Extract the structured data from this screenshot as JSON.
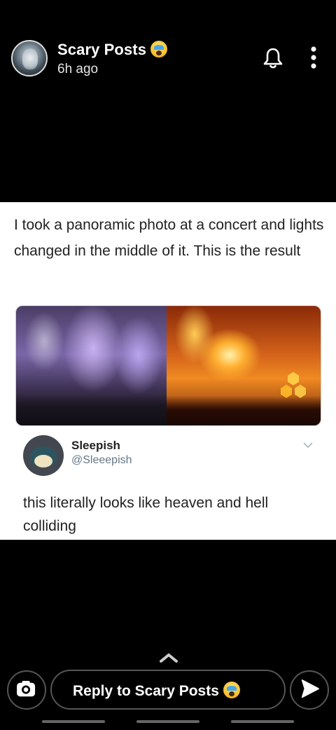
{
  "header": {
    "title": "Scary Posts",
    "title_emoji": "screaming-face-emoji",
    "timestamp": "6h ago",
    "icons": [
      "bell-icon",
      "more-vertical-icon"
    ]
  },
  "post": {
    "caption": "I took a panoramic photo at a concert and lights changed in the middle of it. This is the result",
    "tweet": {
      "name": "Sleepish",
      "handle": "@Sleeepish",
      "text": "this literally looks like heaven and hell colliding"
    }
  },
  "footer": {
    "reply_label": "Reply to Scary Posts",
    "icons": [
      "chevron-up-icon",
      "camera-icon",
      "send-icon"
    ]
  },
  "colors": {
    "background": "#000000",
    "post_background": "#ffffff",
    "text_dark": "#222222",
    "handle_gray": "#657786"
  }
}
